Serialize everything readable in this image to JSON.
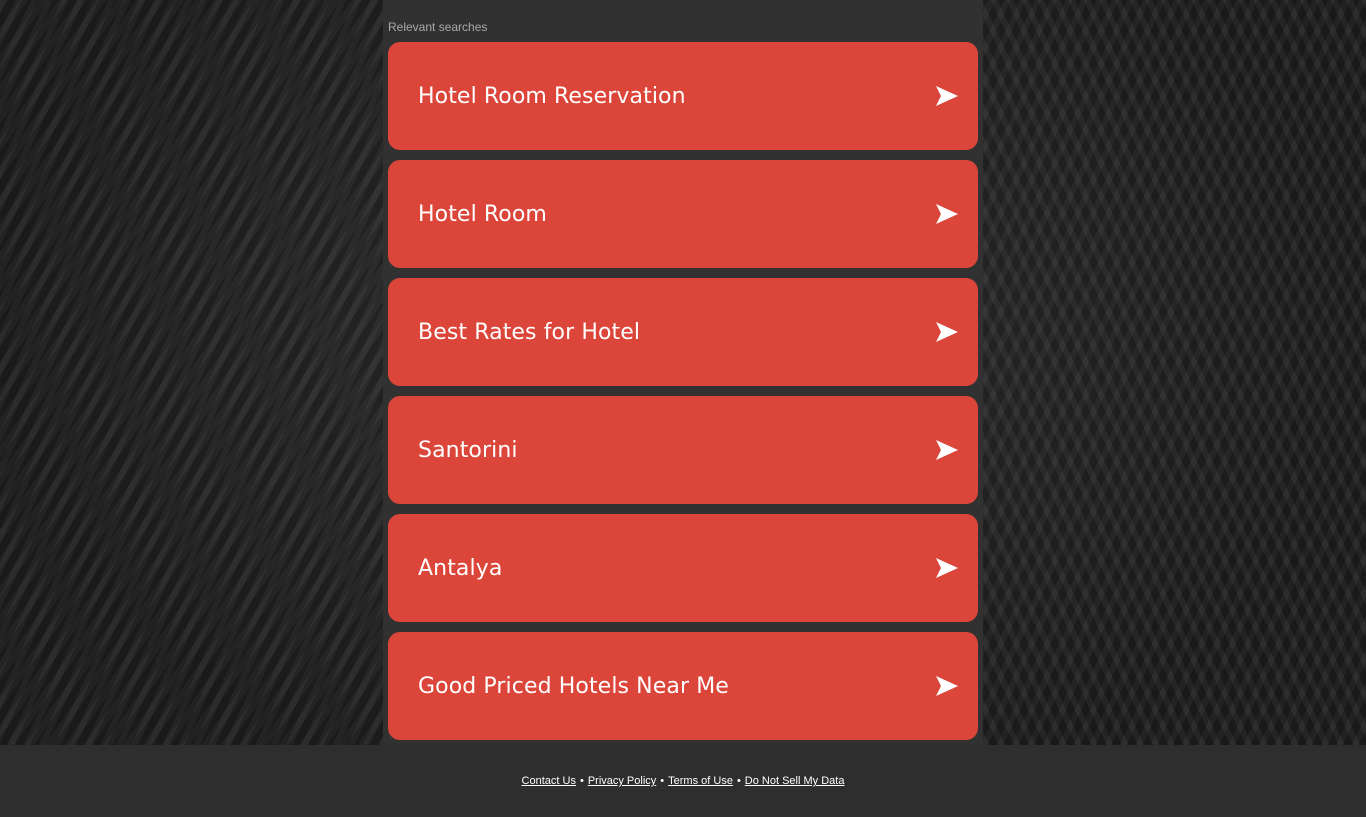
{
  "panel": {
    "heading": "Relevant searches"
  },
  "searches": [
    {
      "label": "Hotel Room Reservation"
    },
    {
      "label": "Hotel Room"
    },
    {
      "label": "Best Rates for Hotel"
    },
    {
      "label": "Santorini"
    },
    {
      "label": "Antalya"
    },
    {
      "label": "Good Priced Hotels Near Me"
    }
  ],
  "card_icon": "send-arrow-icon",
  "colors": {
    "card_background": "#dc4539",
    "panel_background": "#313131",
    "footer_background": "#2e2e2e"
  },
  "footer": {
    "links": [
      {
        "label": "Contact Us"
      },
      {
        "label": "Privacy Policy"
      },
      {
        "label": "Terms of Use"
      },
      {
        "label": "Do Not Sell My Data"
      }
    ],
    "separator": "•"
  }
}
